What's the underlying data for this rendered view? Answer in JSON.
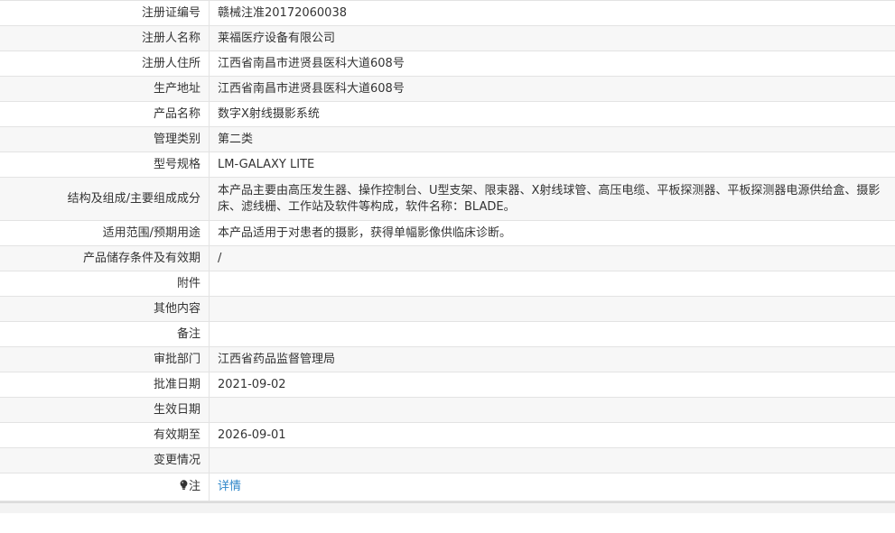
{
  "rows": [
    {
      "label": "注册证编号",
      "value": "赣械注准20172060038"
    },
    {
      "label": "注册人名称",
      "value": "莱福医疗设备有限公司"
    },
    {
      "label": "注册人住所",
      "value": "江西省南昌市进贤县医科大道608号"
    },
    {
      "label": "生产地址",
      "value": "江西省南昌市进贤县医科大道608号"
    },
    {
      "label": "产品名称",
      "value": "数字X射线摄影系统"
    },
    {
      "label": "管理类别",
      "value": "第二类"
    },
    {
      "label": "型号规格",
      "value": "LM-GALAXY LITE"
    },
    {
      "label": "结构及组成/主要组成成分",
      "value": "本产品主要由高压发生器、操作控制台、U型支架、限束器、X射线球管、高压电缆、平板探测器、平板探测器电源供给盒、摄影床、滤线栅、工作站及软件等构成，软件名称：BLADE。"
    },
    {
      "label": "适用范围/预期用途",
      "value": "本产品适用于对患者的摄影，获得单幅影像供临床诊断。"
    },
    {
      "label": "产品储存条件及有效期",
      "value": "/"
    },
    {
      "label": "附件",
      "value": ""
    },
    {
      "label": "其他内容",
      "value": ""
    },
    {
      "label": "备注",
      "value": ""
    },
    {
      "label": "审批部门",
      "value": "江西省药品监督管理局"
    },
    {
      "label": "批准日期",
      "value": "2021-09-02"
    },
    {
      "label": "生效日期",
      "value": ""
    },
    {
      "label": "有效期至",
      "value": "2026-09-01"
    },
    {
      "label": "变更情况",
      "value": ""
    }
  ],
  "note": {
    "label": "注",
    "icon": "lightbulb-icon",
    "link_text": "详情",
    "link_color": "#2e86c9"
  }
}
